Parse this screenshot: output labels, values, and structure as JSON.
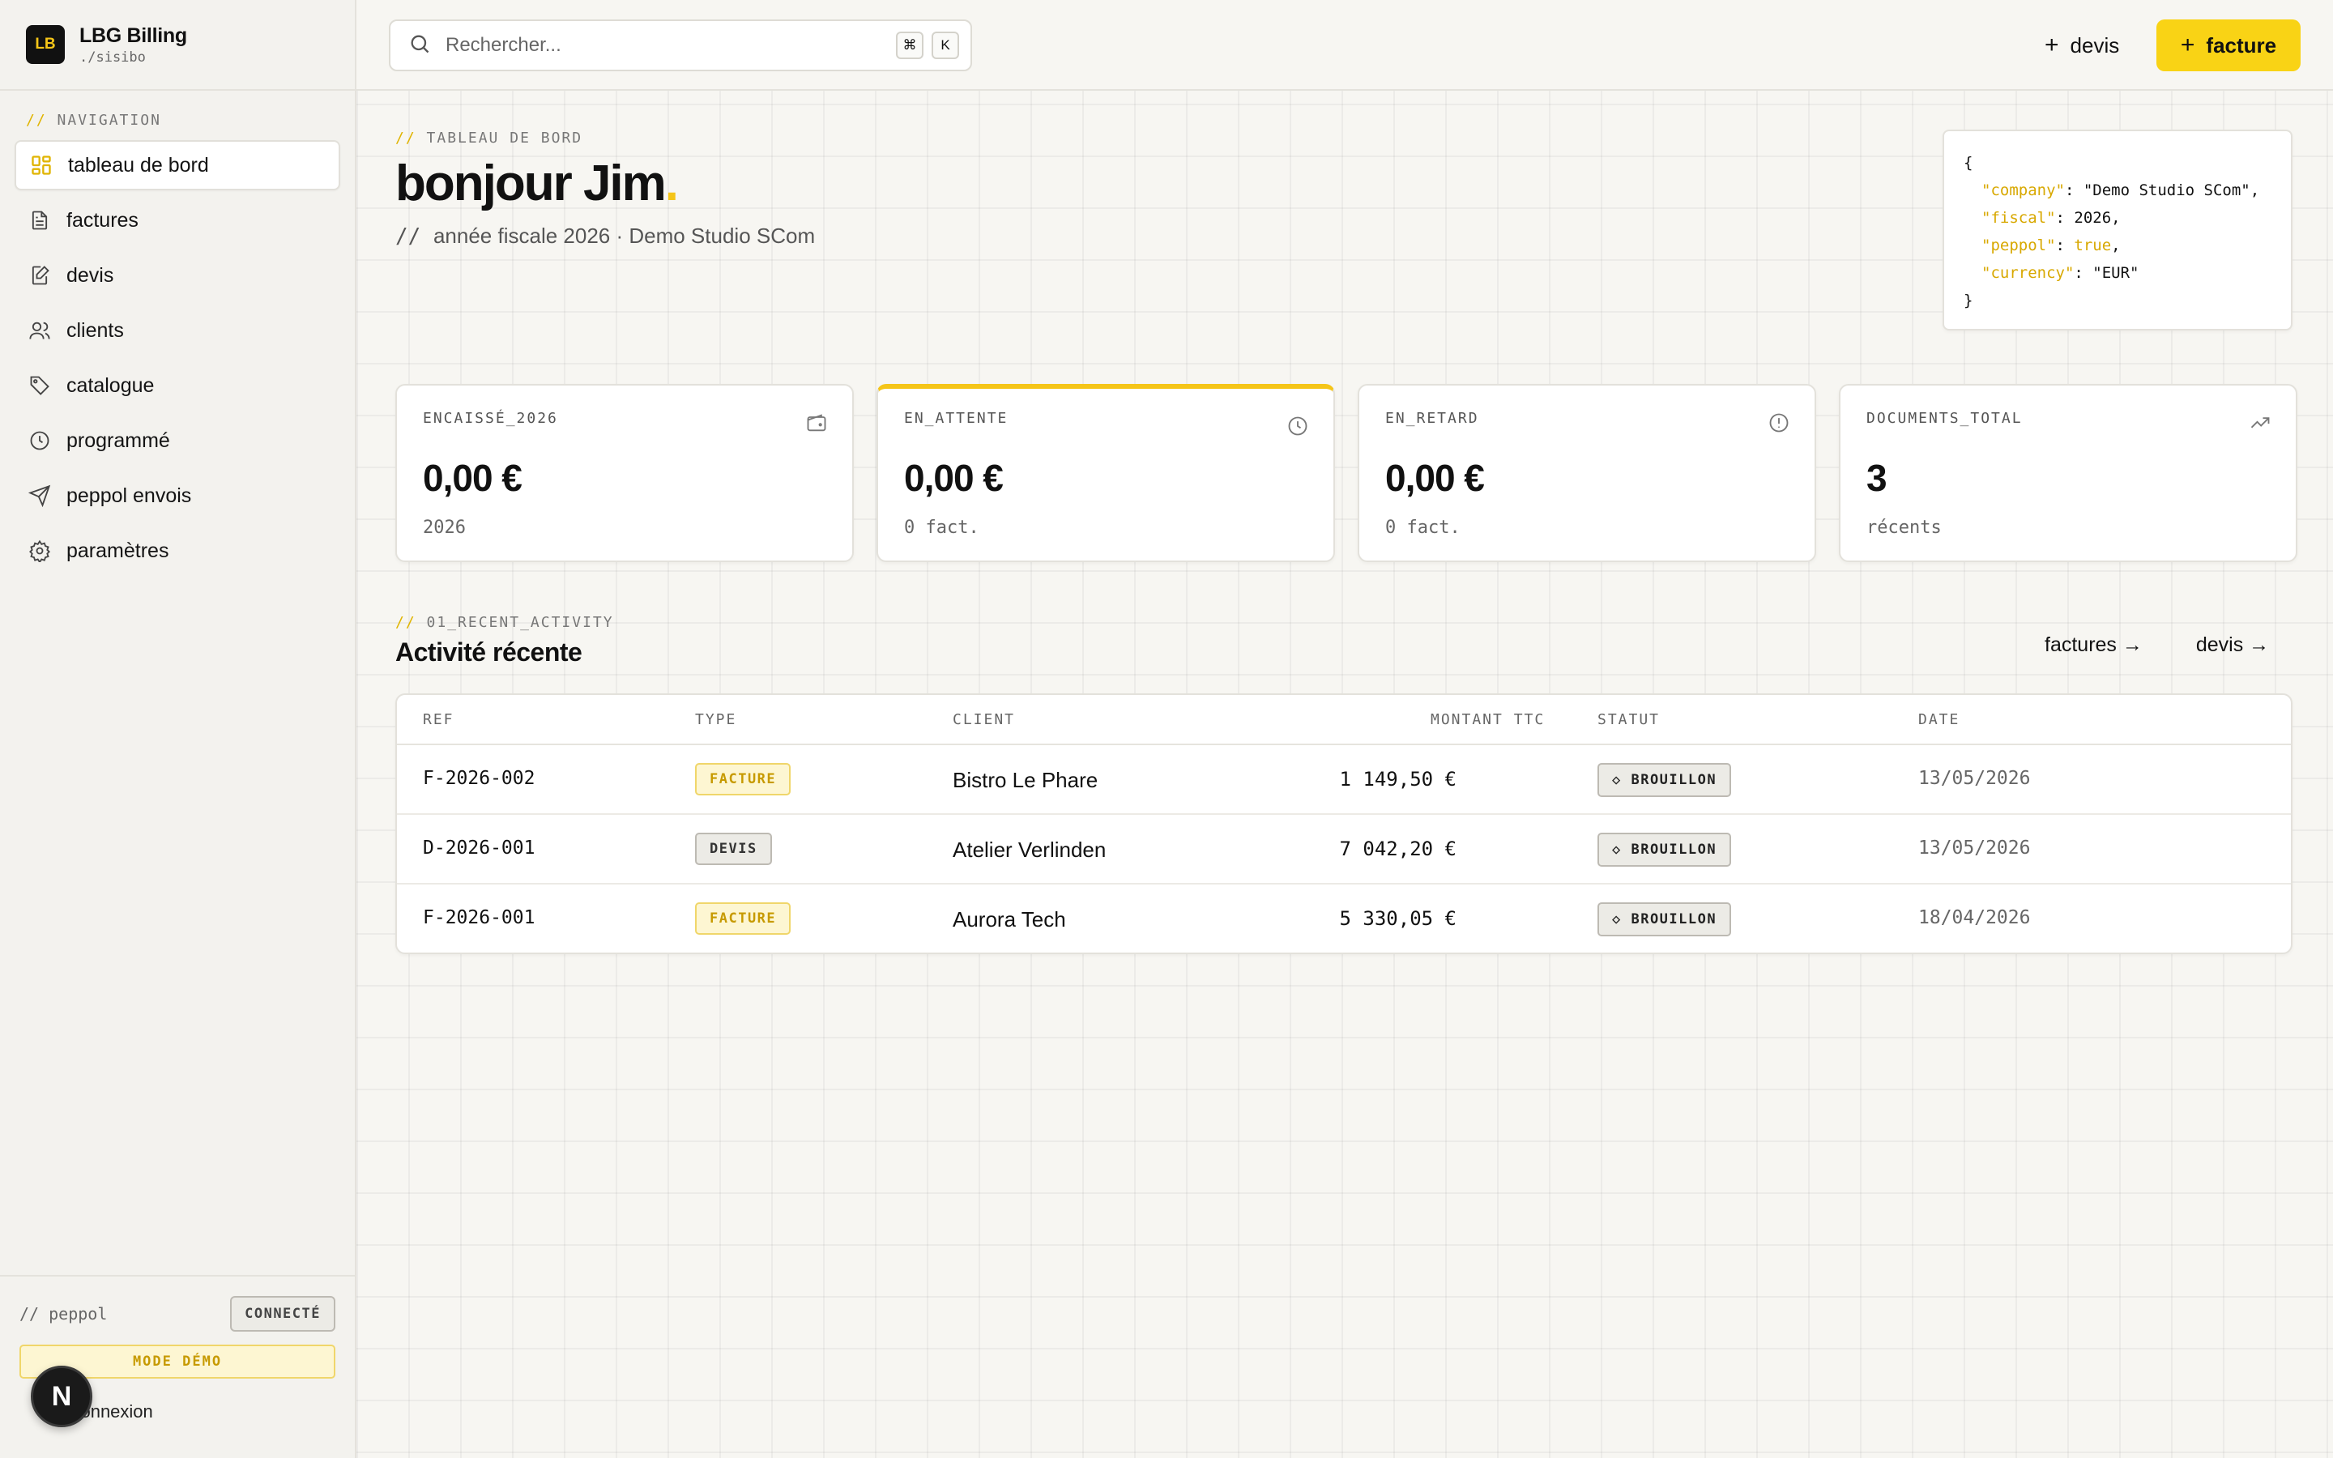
{
  "brand": {
    "logo": "LB",
    "name": "LBG Billing",
    "sub": "./sisibo"
  },
  "nav": {
    "label": "NAVIGATION",
    "items": [
      {
        "label": "tableau de bord",
        "icon": "dashboard-icon"
      },
      {
        "label": "factures",
        "icon": "document-icon"
      },
      {
        "label": "devis",
        "icon": "quote-icon"
      },
      {
        "label": "clients",
        "icon": "users-icon"
      },
      {
        "label": "catalogue",
        "icon": "tag-icon"
      },
      {
        "label": "programmé",
        "icon": "clock-icon"
      },
      {
        "label": "peppol envois",
        "icon": "send-icon"
      },
      {
        "label": "paramètres",
        "icon": "gear-icon"
      }
    ]
  },
  "footer": {
    "peppol_label": "// peppol",
    "peppol_status": "CONNECTÉ",
    "mode": "MODE DÉMO",
    "logout": "déconnexion",
    "avatar": "N"
  },
  "topbar": {
    "search_placeholder": "Rechercher...",
    "kbd1": "⌘",
    "kbd2": "K",
    "devis_label": "devis",
    "facture_label": "facture"
  },
  "hero": {
    "eyebrow": "TABLEAU DE BORD",
    "title": "bonjour Jim",
    "subtitle": "année fiscale 2026 · Demo Studio SCom"
  },
  "json_card": {
    "company_key": "\"company\"",
    "company_val": "\"Demo Studio SCom\"",
    "fiscal_key": "\"fiscal\"",
    "fiscal_val": "2026",
    "peppol_key": "\"peppol\"",
    "peppol_val": "true",
    "currency_key": "\"currency\"",
    "currency_val": "\"EUR\""
  },
  "stats": [
    {
      "label": "ENCAISSÉ_2026",
      "value": "0,00 €",
      "sub": "2026",
      "icon": "wallet-icon"
    },
    {
      "label": "EN_ATTENTE",
      "value": "0,00 €",
      "sub": "0 fact.",
      "icon": "clock-icon"
    },
    {
      "label": "EN_RETARD",
      "value": "0,00 €",
      "sub": "0 fact.",
      "icon": "alert-icon"
    },
    {
      "label": "DOCUMENTS_TOTAL",
      "value": "3",
      "sub": "récents",
      "icon": "trend-up-icon"
    }
  ],
  "activity": {
    "eyebrow": "01_RECENT_ACTIVITY",
    "title": "Activité récente",
    "link_factures": "factures →",
    "link_devis": "devis →",
    "columns": [
      "REF",
      "TYPE",
      "CLIENT",
      "MONTANT TTC",
      "STATUT",
      "DATE"
    ],
    "rows": [
      {
        "ref": "F-2026-002",
        "type": "FACTURE",
        "client": "Bistro Le Phare",
        "amount": "1 149,50 €",
        "status": "◇ BROUILLON",
        "date": "13/05/2026"
      },
      {
        "ref": "D-2026-001",
        "type": "DEVIS",
        "client": "Atelier Verlinden",
        "amount": "7 042,20 €",
        "status": "◇ BROUILLON",
        "date": "13/05/2026"
      },
      {
        "ref": "F-2026-001",
        "type": "FACTURE",
        "client": "Aurora Tech",
        "amount": "5 330,05 €",
        "status": "◇ BROUILLON",
        "date": "18/04/2026"
      }
    ]
  },
  "colors": {
    "accent": "#f5c518",
    "sidebar_bg": "#f3f2ee",
    "page_bg": "#f7f6f2"
  }
}
